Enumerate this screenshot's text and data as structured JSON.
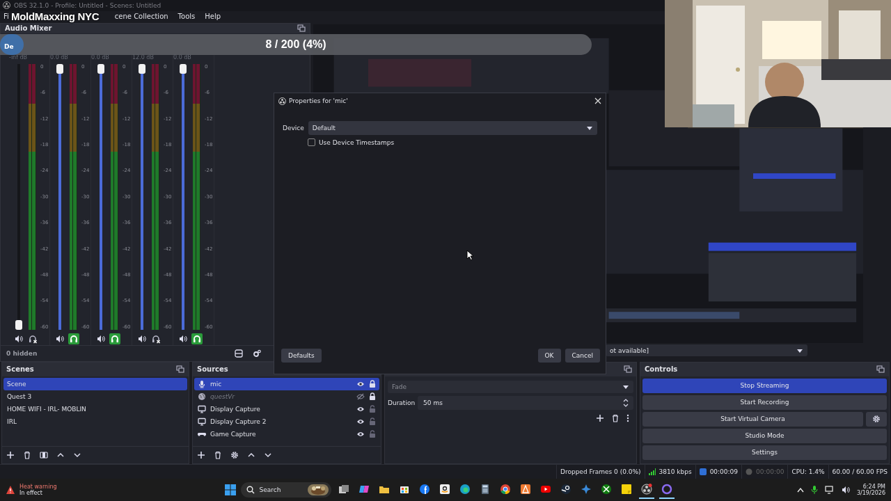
{
  "window": {
    "title": "OBS 32.1.0 - Profile: Untitled - Scenes: Untitled"
  },
  "menu": [
    "Fi",
    "cene Collection",
    "Tools",
    "Help"
  ],
  "overlay": {
    "title": "MoldMaxxing NYC",
    "progress": {
      "label": "8 / 200 (4%)",
      "level": 0.04
    }
  },
  "audio_mixer": {
    "title": "Audio Mixer",
    "source_label": "De",
    "hidden_count": "0 hidden",
    "channels": [
      {
        "reading": "-inf dB",
        "fader": {
          "level": 0
        },
        "monitoring": false,
        "scale": [
          "0",
          "-6",
          "-12",
          "-18",
          "-24",
          "-30",
          "-36",
          "-42",
          "-48",
          "-54",
          "-60"
        ]
      },
      {
        "reading": "0.0 dB",
        "fader": {
          "level": 1
        },
        "monitoring": true,
        "scale": [
          "0",
          "-6",
          "-12",
          "-18",
          "-24",
          "-30",
          "-36",
          "-42",
          "-48",
          "-54",
          "-60"
        ]
      },
      {
        "reading": "0.0 dB",
        "fader": {
          "level": 1
        },
        "monitoring": true,
        "scale": [
          "0",
          "-6",
          "-12",
          "-18",
          "-24",
          "-30",
          "-36",
          "-42",
          "-48",
          "-54",
          "-60"
        ]
      },
      {
        "reading": "12.0 dB",
        "fader": {
          "level": 1
        },
        "monitoring": false,
        "scale": [
          "0",
          "-6",
          "-12",
          "-18",
          "-24",
          "-30",
          "-36",
          "-42",
          "-48",
          "-54",
          "-60"
        ]
      },
      {
        "reading": "0.0 dB",
        "fader": {
          "level": 1
        },
        "monitoring": true,
        "scale": [
          "0",
          "-6",
          "-12",
          "-18",
          "-24",
          "-30",
          "-36",
          "-42",
          "-48",
          "-54",
          "-60"
        ]
      }
    ]
  },
  "context_bar": {
    "device": "ot available]"
  },
  "scenes": {
    "title": "Scenes",
    "items": [
      {
        "label": "Scene",
        "selected": true
      },
      {
        "label": "Quest 3",
        "selected": false
      },
      {
        "label": "HOME WIFI - IRL- MOBLIN",
        "selected": false
      },
      {
        "label": "IRL",
        "selected": false
      }
    ]
  },
  "sources": {
    "title": "Sources",
    "items": [
      {
        "label": "mic",
        "kind": "mic",
        "selected": true,
        "visible": true,
        "locked": true
      },
      {
        "label": "questVr",
        "kind": "browser",
        "selected": false,
        "visible": false,
        "locked": true
      },
      {
        "label": "Display Capture",
        "kind": "display",
        "selected": false,
        "visible": true,
        "locked": false
      },
      {
        "label": "Display Capture 2",
        "kind": "display",
        "selected": false,
        "visible": true,
        "locked": false
      },
      {
        "label": "Game Capture",
        "kind": "game",
        "selected": false,
        "visible": true,
        "locked": false
      }
    ]
  },
  "transitions": {
    "transition": "Fade",
    "duration_label": "Duration",
    "duration": "50 ms"
  },
  "controls": {
    "title": "Controls",
    "buttons": [
      {
        "label": "Stop Streaming",
        "active": true,
        "has_settings": false
      },
      {
        "label": "Start Recording",
        "active": false,
        "has_settings": false
      },
      {
        "label": "Start Virtual Camera",
        "active": false,
        "has_settings": true
      },
      {
        "label": "Studio Mode",
        "active": false,
        "has_settings": false
      },
      {
        "label": "Settings",
        "active": false,
        "has_settings": false
      }
    ]
  },
  "status_bar": {
    "dropped_frames": "Dropped Frames 0 (0.0%)",
    "bitrate": "3810 kbps",
    "streaming": true,
    "stream_time": "00:00:09",
    "recording": false,
    "record_time": "00:00:00",
    "cpu": "CPU: 1.4%",
    "fps": "60.00 / 60.00 FPS"
  },
  "dialog": {
    "title": "Properties for 'mic'",
    "device_label": "Device",
    "device": "Default",
    "timestamps": {
      "label": "Use Device Timestamps",
      "checked": false
    },
    "defaults": "Defaults",
    "ok": "OK",
    "cancel": "Cancel"
  },
  "taskbar": {
    "alert": {
      "title": "Heat warning",
      "subtitle": "In effect"
    },
    "search": "Search",
    "apps": [
      {
        "kind": "taskview",
        "running": false
      },
      {
        "kind": "copilot",
        "running": false
      },
      {
        "kind": "folder",
        "running": false
      },
      {
        "kind": "store",
        "running": false
      },
      {
        "kind": "facebook",
        "running": false
      },
      {
        "kind": "amazon",
        "running": false
      },
      {
        "kind": "edge",
        "running": false
      },
      {
        "kind": "calculator",
        "running": false
      },
      {
        "kind": "chrome",
        "running": false
      },
      {
        "kind": "cone",
        "running": false
      },
      {
        "kind": "youtube",
        "running": false
      },
      {
        "kind": "steam",
        "running": false
      },
      {
        "kind": "hub",
        "running": false
      },
      {
        "kind": "xbox",
        "running": false
      },
      {
        "kind": "notes",
        "running": false
      },
      {
        "kind": "obs",
        "running": true
      },
      {
        "kind": "ring",
        "running": true
      }
    ],
    "time": "6:24 PM",
    "date": "3/19/2026"
  }
}
